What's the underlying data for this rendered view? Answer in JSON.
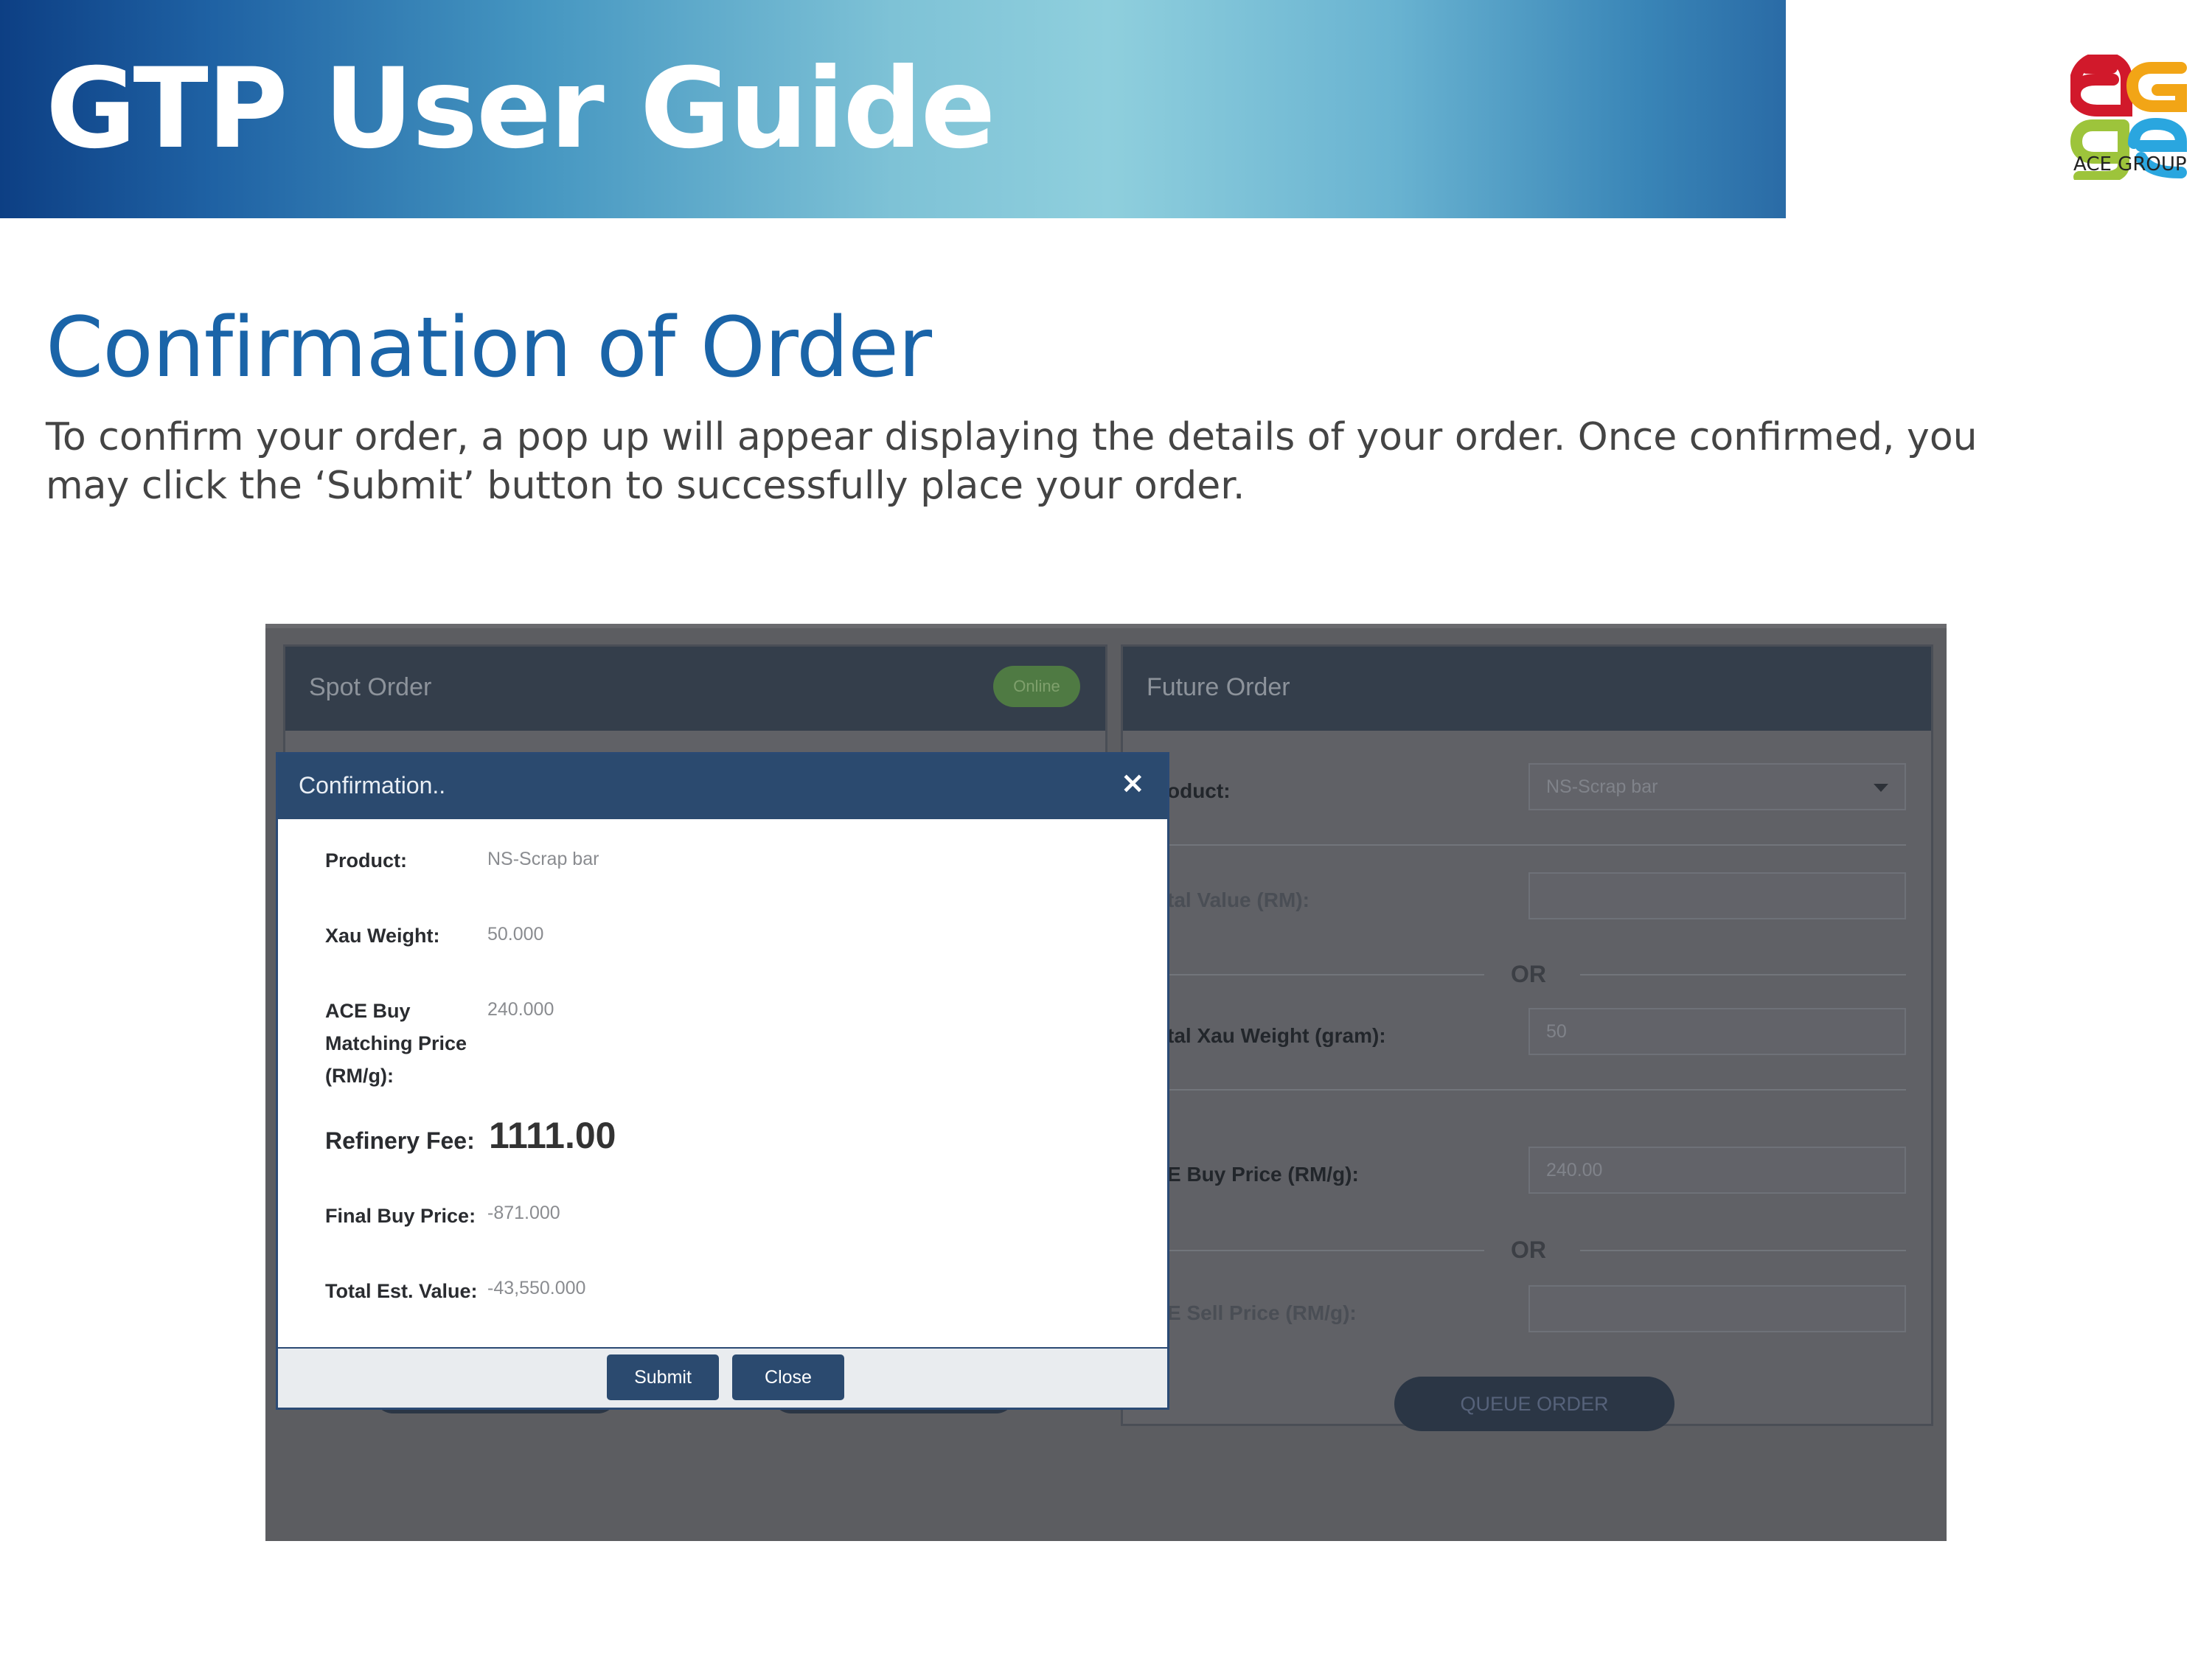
{
  "header": {
    "title": "GTP User Guide"
  },
  "brand": {
    "logo_icon": "ace-group-logo",
    "logo_text": "ACE GROUP"
  },
  "section": {
    "title": "Confirmation of Order",
    "body": "To confirm your order, a pop up will appear displaying the details of your order. Once confirmed, you may click the ‘Submit’ button to successfully place your order."
  },
  "screenshot": {
    "spot_order": {
      "title": "Spot Order",
      "status": "Online"
    },
    "future_order": {
      "title": "Future Order",
      "product_label": "oduct:",
      "product_value": "NS-Scrap bar",
      "total_value_label": "tal Value (RM):",
      "total_value_value": "",
      "or_1": "OR",
      "xau_weight_label": "tal Xau Weight (gram):",
      "xau_weight_value": "50",
      "buy_price_label": "E Buy Price (RM/g):",
      "buy_price_value": "240.00",
      "or_2": "OR",
      "sell_price_label": "E Sell Price (RM/g):",
      "sell_price_value": "",
      "queue_button": "QUEUE ORDER"
    },
    "modal": {
      "title": "Confirmation..",
      "close_icon": "×",
      "rows": {
        "product": {
          "label": "Product:",
          "value": "NS-Scrap bar"
        },
        "xau_weight": {
          "label": "Xau Weight:",
          "value": "50.000"
        },
        "matching_price": {
          "label_1": "ACE Buy",
          "label_2": "Matching Price",
          "label_3": "(RM/g):",
          "value": "240.000"
        },
        "refinery_fee": {
          "label": "Refinery Fee:",
          "value": "1111.00"
        },
        "final_buy_price": {
          "label": "Final Buy Price:",
          "value": "-871.000"
        },
        "total_est_value": {
          "label": "Total Est. Value:",
          "value": "-43,550.000"
        }
      },
      "submit_button": "Submit",
      "close_button": "Close"
    }
  },
  "colors": {
    "brand_blue": "#1a64a8",
    "modal_header": "#2b4a6f",
    "online_green": "#4f7a43"
  }
}
